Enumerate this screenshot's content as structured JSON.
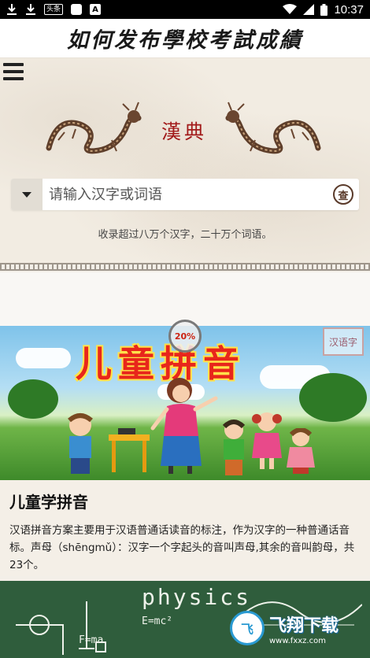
{
  "status_bar": {
    "time": "10:37",
    "left_icons": [
      "download-icon",
      "download-icon",
      "toutiao-icon",
      "square-icon",
      "a-icon"
    ],
    "badge_text": "头条",
    "a_text": "A"
  },
  "app": {
    "title": "如何发布學校考試成績"
  },
  "header": {
    "logo_text": "漢典",
    "search_placeholder": "请输入汉字或词语",
    "search_button_glyph": "查",
    "note": "收录超过八万个汉字，二十万个词语。"
  },
  "cards": [
    {
      "image_title": "儿童拼音",
      "stamp": "汉语字",
      "badge": "20%",
      "title": "儿童学拼音",
      "description": "汉语拼音方案主要用于汉语普通话读音的标注，作为汉字的一种普通话音标。声母（shēngmǔ）：汉字一个字起头的音叫声母,其余的音叫韵母，共23个。"
    },
    {
      "image_title": "physics",
      "formula1": "E=mc²",
      "formula2": "F=ma"
    }
  ],
  "watermark": {
    "main": "飞翔下载",
    "sub": "www.fxxz.com",
    "logo": "飞"
  },
  "colors": {
    "accent_red": "#a21a1a",
    "chalkboard": "#2f5d3c"
  }
}
